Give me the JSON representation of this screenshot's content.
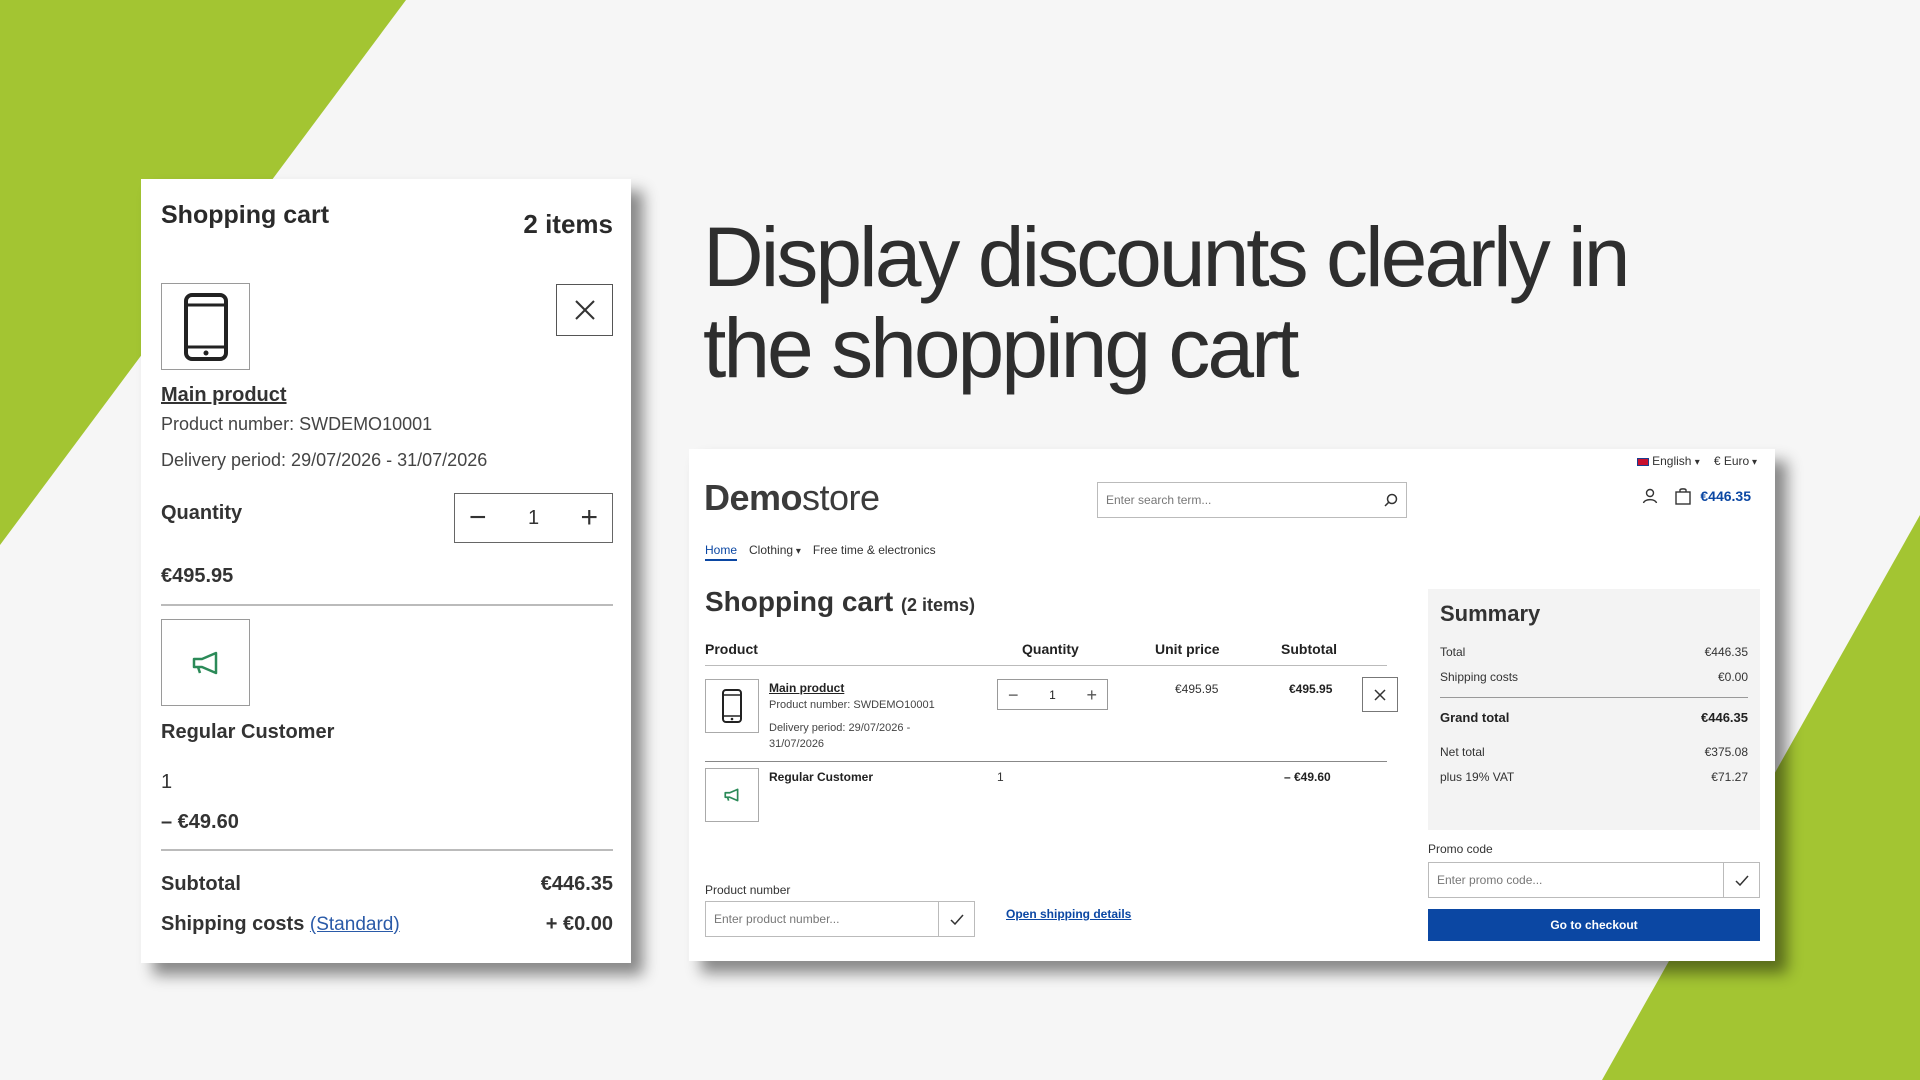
{
  "colors": {
    "accent_green": "#a3c532",
    "brand_blue": "#0b47a3",
    "promo_green": "#2b8a58"
  },
  "headline": {
    "line1": "Display discounts clearly in",
    "line2": "the shopping cart"
  },
  "mini_cart": {
    "title": "Shopping cart",
    "item_count": "2 items",
    "product": {
      "name": "Main product",
      "product_number": "Product number: SWDEMO10001",
      "delivery": "Delivery period: 29/07/2026 - 31/07/2026",
      "quantity_label": "Quantity",
      "quantity": "1",
      "price": "€495.95",
      "icon": "smartphone-icon"
    },
    "discount": {
      "name": "Regular Customer",
      "quantity": "1",
      "amount": "– €49.60",
      "icon": "megaphone-icon"
    },
    "subtotal_label": "Subtotal",
    "subtotal_value": "€446.35",
    "shipping_label": "Shipping costs",
    "shipping_method": "(Standard)",
    "shipping_value": "+ €0.00"
  },
  "store": {
    "language": "English",
    "currency": "€ Euro",
    "logo_bold": "Demo",
    "logo_light": "store",
    "search_placeholder": "Enter search term...",
    "header_cart_total": "€446.35",
    "nav": [
      "Home",
      "Clothing",
      "Free time & electronics"
    ],
    "page_title": "Shopping cart",
    "page_count": "(2 items)",
    "columns": {
      "product": "Product",
      "quantity": "Quantity",
      "unit_price": "Unit price",
      "subtotal": "Subtotal"
    },
    "line_item": {
      "name": "Main product",
      "number": "Product number: SWDEMO10001",
      "delivery_1": "Delivery period: 29/07/2026 -",
      "delivery_2": "31/07/2026",
      "quantity": "1",
      "unit_price": "€495.95",
      "subtotal": "€495.95"
    },
    "discount_item": {
      "name": "Regular Customer",
      "quantity": "1",
      "subtotal": "– €49.60"
    },
    "product_number_label": "Product number",
    "product_number_placeholder": "Enter product number...",
    "shipping_link": "Open shipping details",
    "summary": {
      "title": "Summary",
      "total_label": "Total",
      "total_value": "€446.35",
      "shipping_label": "Shipping costs",
      "shipping_value": "€0.00",
      "grand_label": "Grand total",
      "grand_value": "€446.35",
      "net_label": "Net total",
      "net_value": "€375.08",
      "vat_label": "plus 19% VAT",
      "vat_value": "€71.27"
    },
    "promo_label": "Promo code",
    "promo_placeholder": "Enter promo code...",
    "checkout_label": "Go to checkout"
  }
}
